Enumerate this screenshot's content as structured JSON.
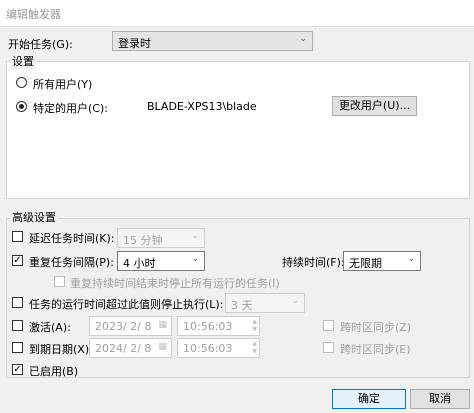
{
  "window": {
    "title": "编辑触发器"
  },
  "start_task": {
    "label": "开始任务(G):",
    "value": "登录时"
  },
  "settings": {
    "label": "设置",
    "all_users": "所有用户(Y)",
    "specific_user": "特定的用户(C):",
    "user_name": "BLADE-XPS13\\blade",
    "change_user": "更改用户(U)..."
  },
  "advanced": {
    "label": "高级设置",
    "delay": {
      "label": "延迟任务时间(K):",
      "value": "15 分钟",
      "checked": false
    },
    "repeat": {
      "label": "重复任务间隔(P):",
      "value": "4 小时",
      "checked": true
    },
    "duration": {
      "label": "持续时间(F):",
      "value": "无限期"
    },
    "stop_all": {
      "label": "重复持续时间结束时停止所有运行的任务(I)"
    },
    "stop_long": {
      "label": "任务的运行时间超过此值则停止执行(L):",
      "value": "3 天"
    },
    "activate": {
      "label": "激活(A):",
      "date": "2023/ 2/ 8",
      "time": "10:56:03",
      "sync": "跨时区同步(Z)"
    },
    "expire": {
      "label": "到期日期(X):",
      "date": "2024/ 2/ 8",
      "time": "10:56:03",
      "sync": "跨时区同步(E)"
    },
    "enabled": {
      "label": "已启用(B)",
      "checked": true
    }
  },
  "buttons": {
    "ok": "确定",
    "cancel": "取消"
  },
  "icons": {
    "check": "✓",
    "chevron": "⌄",
    "calendar": "▦"
  }
}
